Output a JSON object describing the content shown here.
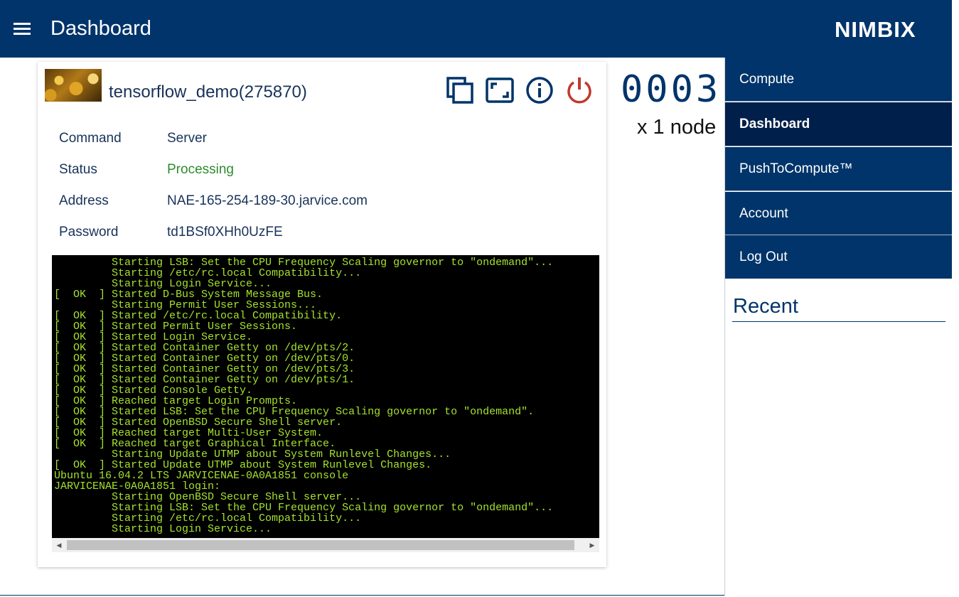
{
  "header": {
    "title": "Dashboard",
    "logo": "NIMBIX",
    "menu_icon": "hamburger-menu-icon"
  },
  "job": {
    "name": "tensorflow_demo(275870)",
    "thumbnail": "coins-thumbnail-image",
    "actions": [
      "copy-icon",
      "fullscreen-icon",
      "info-icon",
      "power-icon"
    ],
    "power_color": "#c0392b",
    "fields": [
      {
        "label": "Command",
        "value": "Server"
      },
      {
        "label": "Status",
        "value": "Processing"
      },
      {
        "label": "Address",
        "value": "NAE-165-254-189-30.jarvice.com"
      },
      {
        "label": "Password",
        "value": "td1BSf0XHh0UzFE"
      }
    ],
    "status_color": "#2e8b2e",
    "console_lines": [
      "         Starting LSB: Set the CPU Frequency Scaling governor to \"ondemand\"...",
      "         Starting /etc/rc.local Compatibility...",
      "         Starting Login Service...",
      "[  OK  ] Started D-Bus System Message Bus.",
      "         Starting Permit User Sessions...",
      "[  OK  ] Started /etc/rc.local Compatibility.",
      "[  OK  ] Started Permit User Sessions.",
      "[  OK  ] Started Login Service.",
      "[  OK  ] Started Container Getty on /dev/pts/2.",
      "[  OK  ] Started Container Getty on /dev/pts/0.",
      "[  OK  ] Started Container Getty on /dev/pts/3.",
      "[  OK  ] Started Container Getty on /dev/pts/1.",
      "[  OK  ] Started Console Getty.",
      "[  OK  ] Reached target Login Prompts.",
      "[  OK  ] Started LSB: Set the CPU Frequency Scaling governor to \"ondemand\".",
      "[  OK  ] Started OpenBSD Secure Shell server.",
      "[  OK  ] Reached target Multi-User System.",
      "[  OK  ] Reached target Graphical Interface.",
      "         Starting Update UTMP about System Runlevel Changes...",
      "[  OK  ] Started Update UTMP about System Runlevel Changes.",
      "Ubuntu 16.04.2 LTS JARVICENAE-0A0A1851 console",
      "JARVICENAE-0A0A1851 login:",
      "         Starting OpenBSD Secure Shell server...",
      "         Starting LSB: Set the CPU Frequency Scaling governor to \"ondemand\"...",
      "         Starting /etc/rc.local Compatibility...",
      "         Starting Login Service..."
    ],
    "console_text_color": "#a6e22e"
  },
  "runtime": {
    "counter": "0003",
    "nodes": "x 1 node"
  },
  "sidebar": {
    "items": [
      {
        "label": "Compute",
        "active": false
      },
      {
        "label": "Dashboard",
        "active": true
      },
      {
        "label": "PushToCompute™",
        "active": false
      },
      {
        "label": "Account",
        "active": false
      },
      {
        "label": "Log Out",
        "active": false
      }
    ],
    "recent_title": "Recent"
  },
  "colors": {
    "brand_navy": "#00346a",
    "active_nav": "#001f4a"
  }
}
